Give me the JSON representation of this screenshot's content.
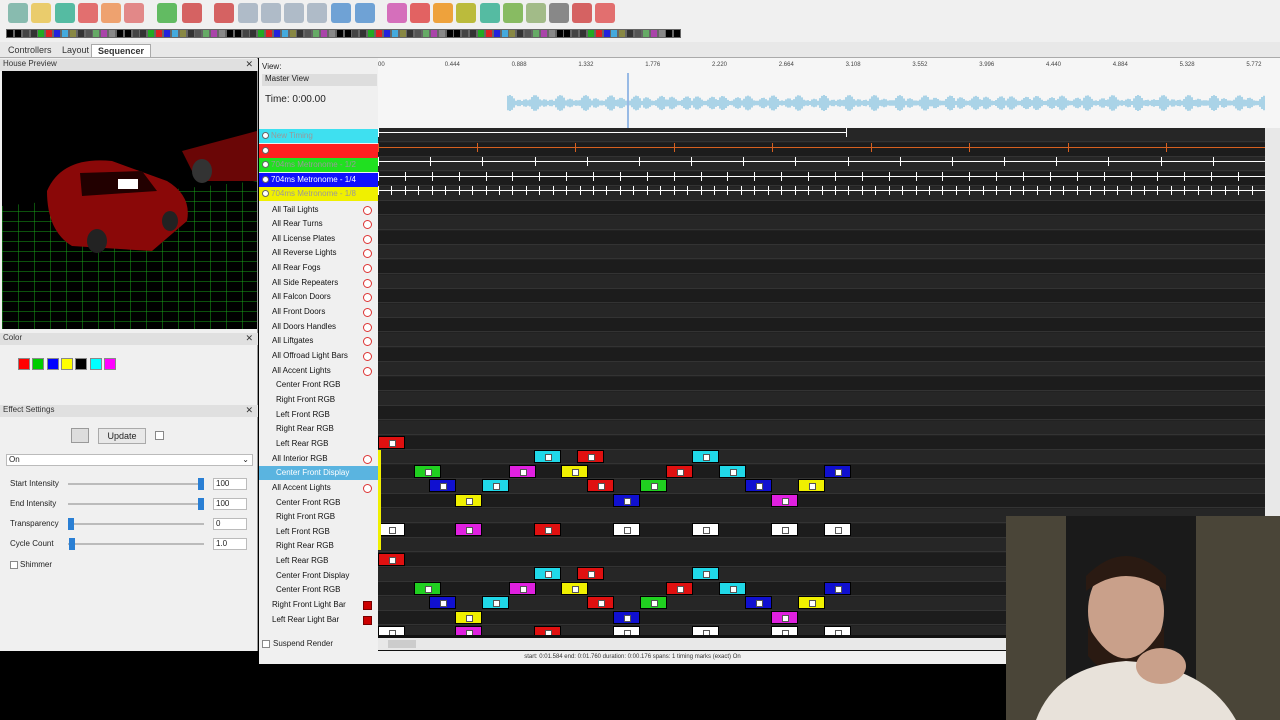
{
  "tabs": [
    "Controllers",
    "Layout",
    "Sequencer"
  ],
  "panes": {
    "house_preview": "House Preview",
    "color": "Color",
    "effect_settings": "Effect Settings"
  },
  "effect": {
    "update_label": "Update",
    "mode": "On",
    "rows": [
      {
        "label": "Start Intensity",
        "value": "100",
        "level": 100
      },
      {
        "label": "End Intensity",
        "value": "100",
        "level": 100
      },
      {
        "label": "Transparency",
        "value": "0",
        "level": 0
      },
      {
        "label": "Cycle Count",
        "value": "1.0",
        "level": 1
      }
    ],
    "shimmer": "Shimmer"
  },
  "sequencer": {
    "view_label": "View:",
    "view_value": "Master View",
    "time": "Time: 0:00.00",
    "ruler": [
      "00",
      "0.444",
      "0.888",
      "1.332",
      "1.776",
      "2.220",
      "2.664",
      "3.108",
      "3.552",
      "3.996",
      "4.440",
      "4.884",
      "5.328",
      "5.772"
    ],
    "timings": [
      {
        "name": "New Timing",
        "color": "#3ee0f0"
      },
      {
        "name": "",
        "color": "#ff2020"
      },
      {
        "name": "704ms Metronome - 1/2",
        "color": "#20e020"
      },
      {
        "name": "704ms Metronome - 1/4",
        "color": "#1010ff"
      },
      {
        "name": "704ms Metronome - 1/8",
        "color": "#f0f000"
      }
    ],
    "models": [
      "All Tail Lights",
      "All Rear Turns",
      "All License Plates",
      "All Reverse Lights",
      "All Rear Fogs",
      "All Side Repeaters",
      "All Falcon Doors",
      "All Front Doors",
      "All Doors Handles",
      "All Liftgates",
      "All Offroad Light Bars",
      "All Accent Lights",
      "Center Front RGB",
      "Right Front RGB",
      "Left Front RGB",
      "Right Rear RGB",
      "Left Rear RGB",
      "All Interior RGB",
      "Center Front Display",
      "All Accent Lights",
      "Center Front RGB",
      "Right Front RGB",
      "Left Front RGB",
      "Right Rear RGB",
      "Left Rear RGB",
      "Center Front Display",
      "Center Front RGB",
      "Right Front Light Bar",
      "Left Rear Light Bar"
    ],
    "suspend": "Suspend Render"
  },
  "status": "start: 0:01.584  end: 0:01.760  duration: 0:00.176  spans: 1 timing marks (exact)  On"
}
